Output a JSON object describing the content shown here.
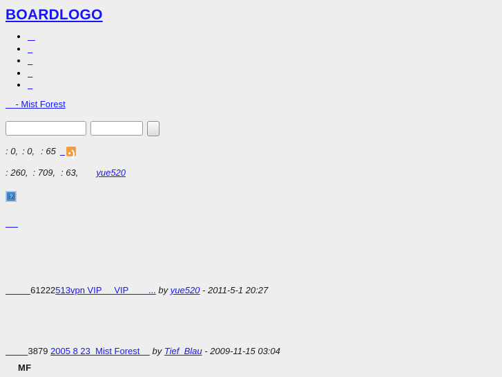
{
  "page": {
    "background_color": "#eeeeee",
    "link_color": "#1414ff",
    "text_color": "#1a1a1a"
  },
  "header": {
    "logo_label": "BOARDLOGO",
    "logo_icon": "board-logo"
  },
  "nav": {
    "items": [
      {
        "label": "   "
      },
      {
        "label": "  "
      },
      {
        "label": "  "
      },
      {
        "label": "  "
      },
      {
        "label": "  "
      }
    ]
  },
  "breadcrumb": {
    "home_label": "   ",
    "tail_label": " - Mist Forest"
  },
  "search": {
    "keyword_value": "",
    "keyword_placeholder": "",
    "scope_value": "",
    "scope_placeholder": "",
    "submit_label": ""
  },
  "stats_primary": {
    "today_label": ": 0,",
    "yesterday_label": ": 0,",
    "total_label": ": 65",
    "feed_link_label": "  ",
    "feed_icon": "rss-icon"
  },
  "stats_secondary": {
    "threads_label": ": 260,",
    "posts_label": ": 709,",
    "members_label": ": 63,",
    "newest_member": "yue520"
  },
  "help": {
    "icon": "help-question-icon",
    "glyph": "?"
  },
  "blank_link": {
    "label": "     "
  },
  "threads": [
    {
      "icon_label": "          ",
      "views": "61222",
      "title": "513vpn VIP     VIP        ...",
      "by_label": " by ",
      "author": "yue520",
      "date": " - 2011-5-1 20:27"
    },
    {
      "icon_label": "         ",
      "views": "3879 ",
      "title": "2005 8 23  Mist Forest    ",
      "by_label": " by ",
      "author": "Tief_Blau",
      "date": " - 2009-11-15 03:04"
    }
  ],
  "footer": {
    "mark": "MF"
  }
}
